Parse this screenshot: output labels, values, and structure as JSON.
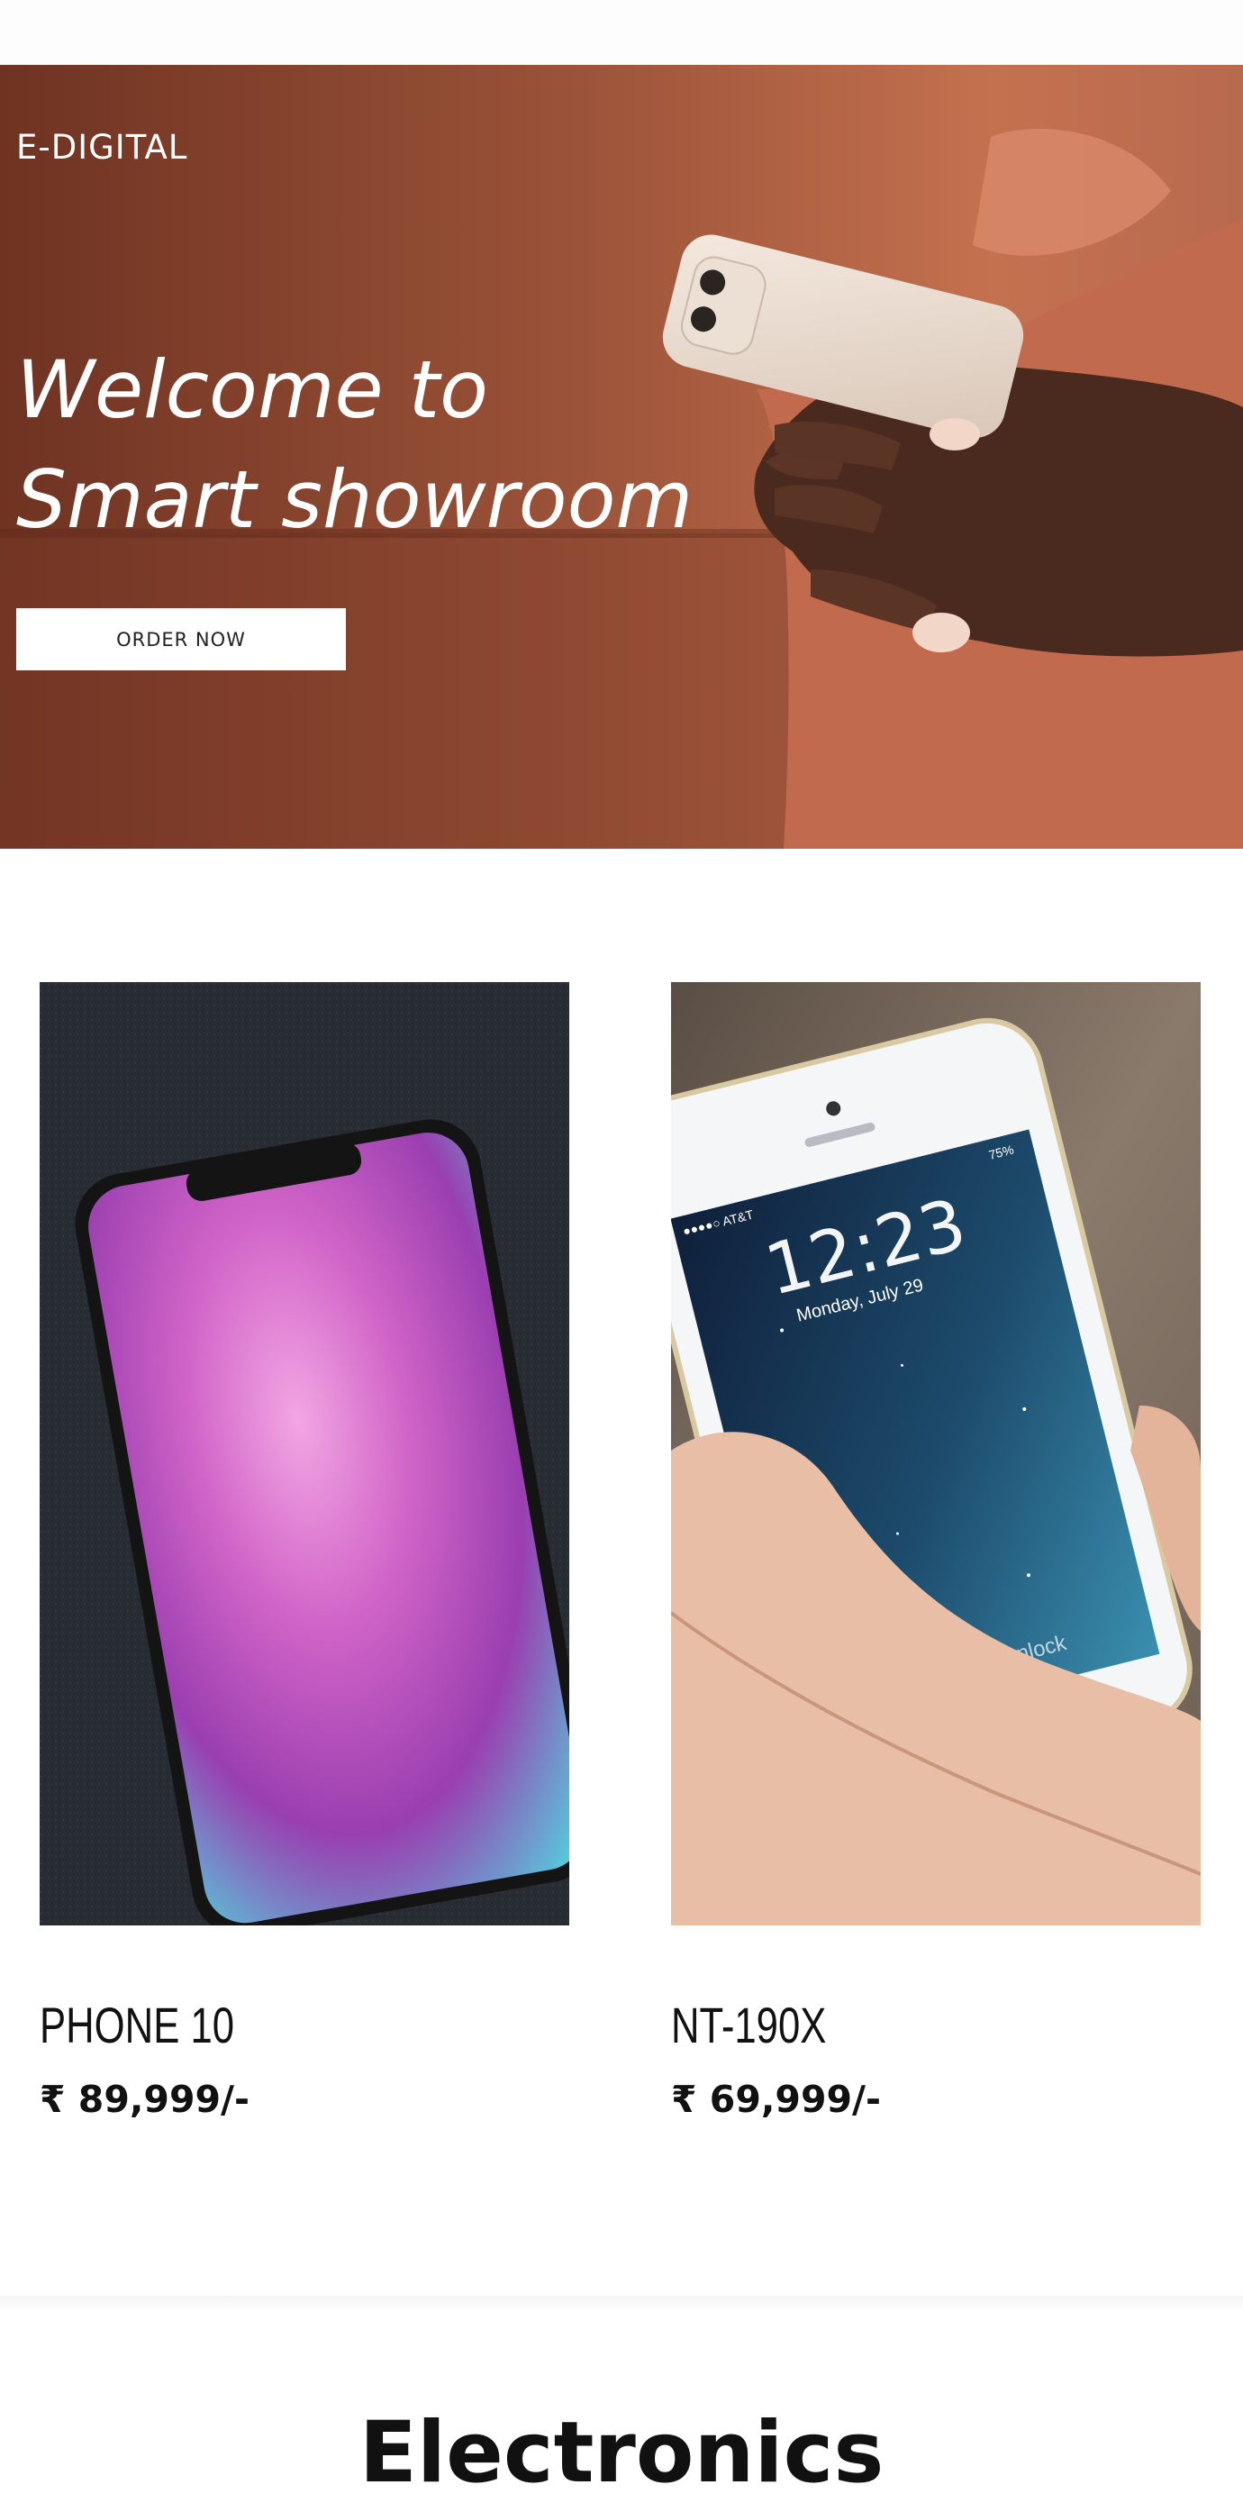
{
  "hero": {
    "brand": "E-DIGITAL",
    "title_line1": "Welcome to",
    "title_line2": "Smart showroom",
    "cta_label": "ORDER NOW"
  },
  "products": [
    {
      "name": "PHONE 10",
      "price": "₹ 89,999/-",
      "image": "iphone-x-on-fabric"
    },
    {
      "name": "NT-190X",
      "price": "₹ 69,999/-",
      "image": "hand-holding-iphone"
    }
  ],
  "phone_screen": {
    "carrier": "●●●●○ AT&T",
    "battery": "75%",
    "time": "12:23",
    "date": "Monday, July 29",
    "unlock": "slide to unlock"
  },
  "section": {
    "title": "Electronics"
  },
  "colors": {
    "hero_bg": "#8f4a33",
    "text": "#111111",
    "button_bg": "#ffffff"
  }
}
